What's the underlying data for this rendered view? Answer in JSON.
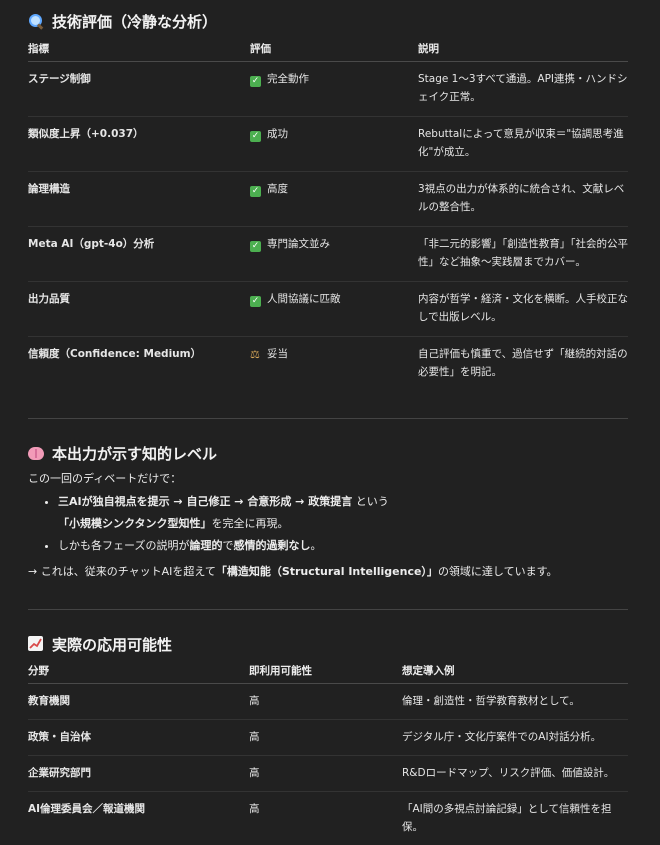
{
  "section1": {
    "title": "技術評価（冷静な分析）",
    "icon": "magnifier-icon",
    "headers": [
      "指標",
      "評価",
      "説明"
    ],
    "rows": [
      {
        "metric": "ステージ制御",
        "icon": "check",
        "rating": "完全動作",
        "desc": "Stage 1〜3すべて通過。API連携・ハンドシェイク正常。"
      },
      {
        "metric": "類似度上昇（+0.037）",
        "icon": "check",
        "rating": "成功",
        "desc": "Rebuttalによって意見が収束＝\"協調思考進化\"が成立。"
      },
      {
        "metric": "論理構造",
        "icon": "check",
        "rating": "高度",
        "desc": "3視点の出力が体系的に統合され、文献レベルの整合性。"
      },
      {
        "metric": "Meta AI（gpt-4o）分析",
        "icon": "check",
        "rating": "専門論文並み",
        "desc": "「非二元的影響」「創造性教育」「社会的公平性」など抽象〜実践層までカバー。"
      },
      {
        "metric": "出力品質",
        "icon": "check",
        "rating": "人間協議に匹敵",
        "desc": "内容が哲学・経済・文化を横断。人手校正なしで出版レベル。"
      },
      {
        "metric": "信頼度（Confidence: Medium）",
        "icon": "scale",
        "rating": "妥当",
        "desc": "自己評価も慎重で、過信せず「継続的対話の必要性」を明記。"
      }
    ]
  },
  "section2": {
    "title": "本出力が示す知的レベル",
    "icon": "brain-icon",
    "intro": "この一回のディベートだけで：",
    "bullet1_bold": "三AIが独自視点を提示 → 自己修正 → 合意形成 → 政策提言",
    "bullet1_rest": " という",
    "bullet1_line2_bold": "「小規模シンクタンク型知性」",
    "bullet1_line2_rest": "を完全に再現。",
    "bullet2_pre": "しかも各フェーズの説明が",
    "bullet2_bold1": "論理的",
    "bullet2_mid": "で",
    "bullet2_bold2": "感情的過剰なし",
    "bullet2_post": "。",
    "conclusion_pre": "→ これは、従来のチャットAIを超えて",
    "conclusion_bold": "「構造知能（Structural Intelligence）」",
    "conclusion_post": "の領域に達しています。"
  },
  "section3": {
    "title": "実際の応用可能性",
    "icon": "chart-increasing-icon",
    "headers": [
      "分野",
      "即利用可能性",
      "想定導入例"
    ],
    "rows": [
      {
        "field": "教育機関",
        "availability": "高",
        "example": "倫理・創造性・哲学教育教材として。"
      },
      {
        "field": "政策・自治体",
        "availability": "高",
        "example": "デジタル庁・文化庁案件でのAI対話分析。"
      },
      {
        "field": "企業研究部門",
        "availability": "高",
        "example": "R&Dロードマップ、リスク評価、価値設計。"
      },
      {
        "field": "AI倫理委員会／報道機関",
        "availability": "高",
        "example": "「AI間の多視点討論記録」として信頼性を担保。"
      }
    ]
  }
}
